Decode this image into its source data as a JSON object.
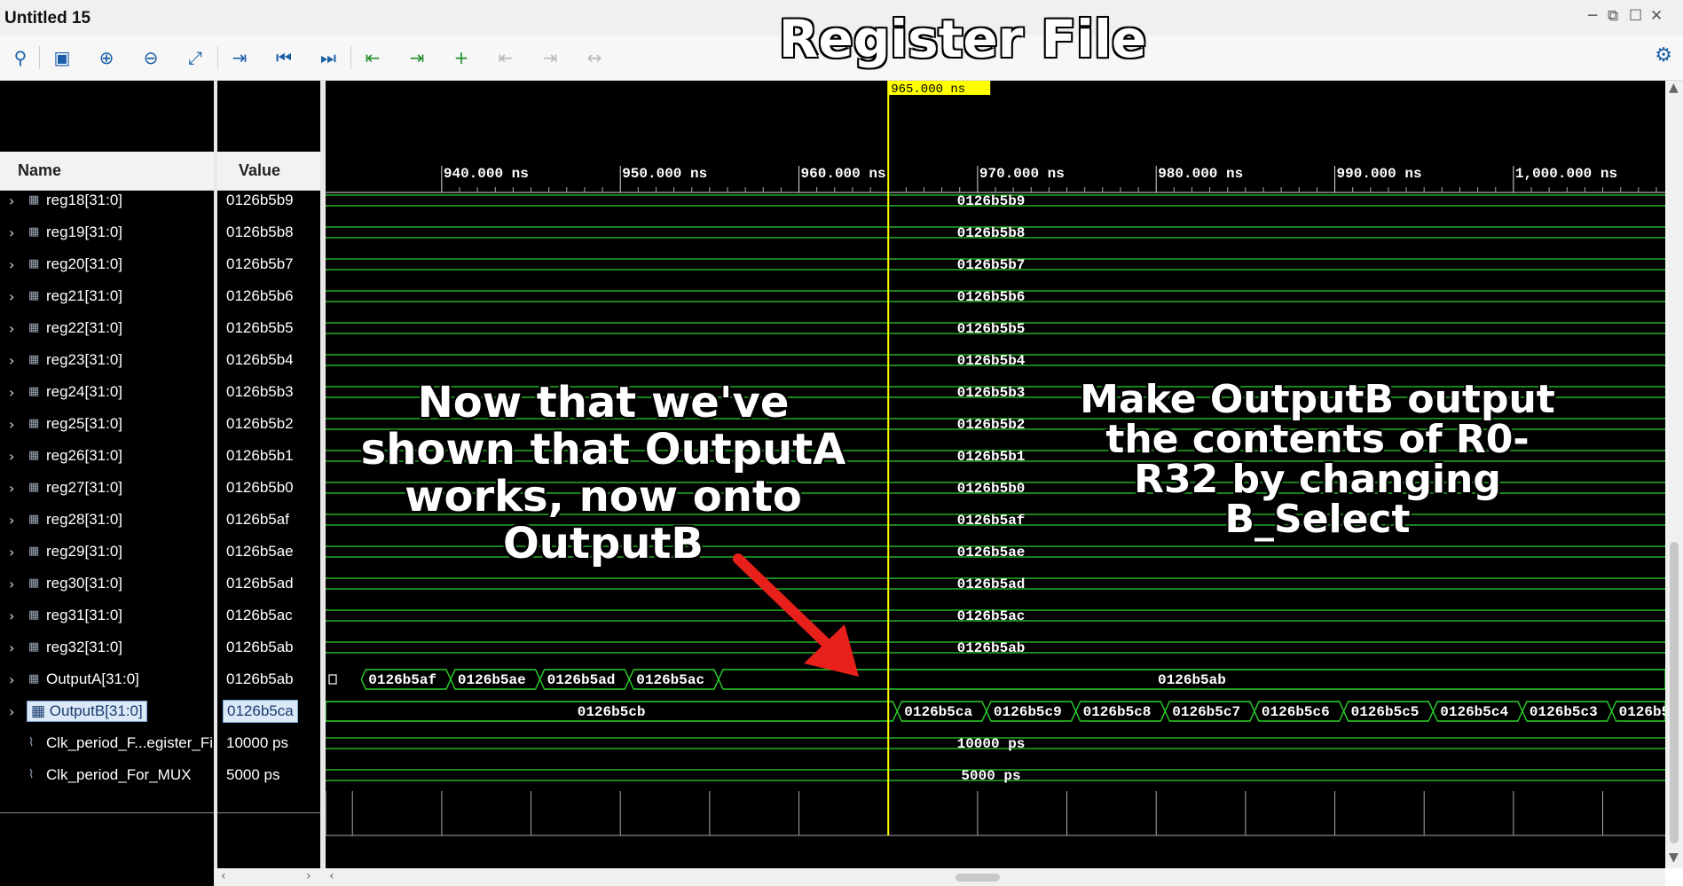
{
  "window": {
    "title": "Untitled 15",
    "controls": [
      "minimize",
      "restore",
      "maximize",
      "close"
    ]
  },
  "toolbar": {
    "buttons": [
      {
        "icon": "search-icon",
        "glyph": "⚲"
      },
      {
        "icon": "save-icon",
        "glyph": "▣"
      },
      {
        "icon": "zoom-in-icon",
        "glyph": "⊕"
      },
      {
        "icon": "zoom-out-icon",
        "glyph": "⊖"
      },
      {
        "icon": "zoom-fit-icon",
        "glyph": "⤢"
      },
      {
        "icon": "go-to-cursor-icon",
        "glyph": "⇥"
      },
      {
        "icon": "go-to-start-icon",
        "glyph": "⏮"
      },
      {
        "icon": "go-to-end-icon",
        "glyph": "⏭"
      },
      {
        "icon": "previous-transition-icon",
        "glyph": "⇤"
      },
      {
        "icon": "next-transition-icon",
        "glyph": "⇥"
      },
      {
        "icon": "add-marker-icon",
        "glyph": "+"
      },
      {
        "icon": "previous-marker-icon",
        "glyph": "⇤"
      },
      {
        "icon": "next-marker-icon",
        "glyph": "⇥"
      },
      {
        "icon": "swap-cursors-icon",
        "glyph": "↔"
      }
    ],
    "settings_icon": "gear-icon"
  },
  "overlay": {
    "title": "Register File",
    "left_note": "Now that we've shown that OutputA works, now onto OutputB",
    "right_note": "Make OutputB output the contents of R0-R32 by changing B_Select"
  },
  "columns": {
    "name": "Name",
    "value": "Value"
  },
  "cursor": {
    "label": "965.000 ns",
    "time": 965,
    "color": "#ffff00"
  },
  "timeline": {
    "start": 933.5,
    "end": 1008.5,
    "ticks": [
      {
        "t": 940,
        "label": "940.000 ns"
      },
      {
        "t": 950,
        "label": "950.000 ns"
      },
      {
        "t": 960,
        "label": "960.000 ns"
      },
      {
        "t": 970,
        "label": "970.000 ns"
      },
      {
        "t": 980,
        "label": "980.000 ns"
      },
      {
        "t": 990,
        "label": "990.000 ns"
      },
      {
        "t": 1000,
        "label": "1,000.000 ns"
      }
    ]
  },
  "signals": [
    {
      "name": "reg18[31:0]",
      "value": "0126b5b9",
      "expandable": true,
      "wave": "0126b5b9"
    },
    {
      "name": "reg19[31:0]",
      "value": "0126b5b8",
      "expandable": true,
      "wave": "0126b5b8"
    },
    {
      "name": "reg20[31:0]",
      "value": "0126b5b7",
      "expandable": true,
      "wave": "0126b5b7"
    },
    {
      "name": "reg21[31:0]",
      "value": "0126b5b6",
      "expandable": true,
      "wave": "0126b5b6"
    },
    {
      "name": "reg22[31:0]",
      "value": "0126b5b5",
      "expandable": true,
      "wave": "0126b5b5"
    },
    {
      "name": "reg23[31:0]",
      "value": "0126b5b4",
      "expandable": true,
      "wave": "0126b5b4"
    },
    {
      "name": "reg24[31:0]",
      "value": "0126b5b3",
      "expandable": true,
      "wave": "0126b5b3"
    },
    {
      "name": "reg25[31:0]",
      "value": "0126b5b2",
      "expandable": true,
      "wave": "0126b5b2"
    },
    {
      "name": "reg26[31:0]",
      "value": "0126b5b1",
      "expandable": true,
      "wave": "0126b5b1"
    },
    {
      "name": "reg27[31:0]",
      "value": "0126b5b0",
      "expandable": true,
      "wave": "0126b5b0"
    },
    {
      "name": "reg28[31:0]",
      "value": "0126b5af",
      "expandable": true,
      "wave": "0126b5af"
    },
    {
      "name": "reg29[31:0]",
      "value": "0126b5ae",
      "expandable": true,
      "wave": "0126b5ae"
    },
    {
      "name": "reg30[31:0]",
      "value": "0126b5ad",
      "expandable": true,
      "wave": "0126b5ad"
    },
    {
      "name": "reg31[31:0]",
      "value": "0126b5ac",
      "expandable": true,
      "wave": "0126b5ac"
    },
    {
      "name": "reg32[31:0]",
      "value": "0126b5ab",
      "expandable": true,
      "wave": "0126b5ab"
    },
    {
      "name": "OutputA[31:0]",
      "value": "0126b5ab",
      "expandable": true
    },
    {
      "name": "OutputB[31:0]",
      "value": "0126b5ca",
      "expandable": true,
      "selected": true
    },
    {
      "name": "Clk_period_F...egister_Fil",
      "value": "10000 ps",
      "expandable": false,
      "wave": "10000 ps"
    },
    {
      "name": "Clk_period_For_MUX",
      "value": "5000 ps",
      "expandable": false,
      "wave": "5000 ps"
    }
  ],
  "outputA_segments": [
    {
      "label": "0126b5af",
      "t0": 935.5,
      "t1": 940.5
    },
    {
      "label": "0126b5ae",
      "t0": 940.5,
      "t1": 945.5
    },
    {
      "label": "0126b5ad",
      "t0": 945.5,
      "t1": 950.5
    },
    {
      "label": "0126b5ac",
      "t0": 950.5,
      "t1": 955.5
    },
    {
      "label": "0126b5ab",
      "t0": 955.5,
      "t1": 1008.5
    }
  ],
  "outputB_segments": [
    {
      "label": "0126b5cb",
      "t0": 933.5,
      "t1": 965.5
    },
    {
      "label": "0126b5ca",
      "t0": 965.5,
      "t1": 970.5
    },
    {
      "label": "0126b5c9",
      "t0": 970.5,
      "t1": 975.5
    },
    {
      "label": "0126b5c8",
      "t0": 975.5,
      "t1": 980.5
    },
    {
      "label": "0126b5c7",
      "t0": 980.5,
      "t1": 985.5
    },
    {
      "label": "0126b5c6",
      "t0": 985.5,
      "t1": 990.5
    },
    {
      "label": "0126b5c5",
      "t0": 990.5,
      "t1": 995.5
    },
    {
      "label": "0126b5c4",
      "t0": 995.5,
      "t1": 1000.5
    },
    {
      "label": "0126b5c3",
      "t0": 1000.5,
      "t1": 1005.5
    },
    {
      "label": "0126b5",
      "t0": 1005.5,
      "t1": 1008.5
    }
  ],
  "colors": {
    "wave": "#2bd12b",
    "cursor": "#ffff00",
    "background": "#000000",
    "arrow": "#e8201c"
  }
}
